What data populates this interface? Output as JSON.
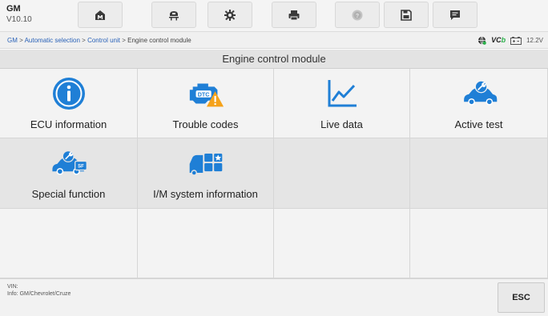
{
  "app": {
    "brand": "GM",
    "version": "V10.10"
  },
  "toolbar": {
    "items": [
      {
        "icon": "home-icon"
      },
      {
        "icon": "vehicle-lift-icon"
      },
      {
        "icon": "settings-gear-icon"
      },
      {
        "icon": "print-icon"
      },
      {
        "icon": "help-icon"
      },
      {
        "icon": "save-icon"
      },
      {
        "icon": "message-icon"
      }
    ]
  },
  "breadcrumb": {
    "links": [
      "GM",
      "Automatic selection",
      "Control unit"
    ],
    "separator": " > ",
    "current": "Engine control module"
  },
  "status": {
    "vci_prefix": "VC",
    "vci_suffix": "b",
    "voltage": "12.2V"
  },
  "page": {
    "title": "Engine control module"
  },
  "functions": [
    {
      "label": "ECU information",
      "icon": "info-icon"
    },
    {
      "label": "Trouble codes",
      "icon": "dtc-engine-warning-icon",
      "icon_text": "DTC"
    },
    {
      "label": "Live data",
      "icon": "line-chart-icon"
    },
    {
      "label": "Active test",
      "icon": "car-wrench-icon"
    },
    {
      "label": "Special function",
      "icon": "car-special-function-icon",
      "icon_text": "SF"
    },
    {
      "label": "I/M system information",
      "icon": "car-grid-star-icon"
    }
  ],
  "footer": {
    "vin_label": "VIN:",
    "info": "Info: GM/Chevrolet/Cruze",
    "esc_label": "ESC"
  },
  "colors": {
    "accent_blue": "#1f7fd6",
    "warning_orange": "#f5a21a",
    "link_blue": "#2a62b8",
    "vci_green": "#2bb04a"
  }
}
